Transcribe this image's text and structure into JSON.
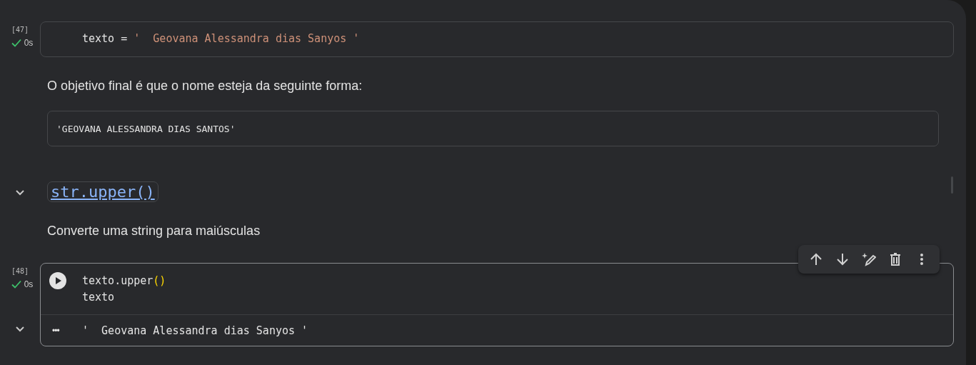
{
  "cells": [
    {
      "kind": "code",
      "exec_count": "[47]",
      "status": "0s",
      "selected": false,
      "lines": [
        [
          {
            "kind": "plain",
            "text": "texto = "
          },
          {
            "kind": "string",
            "text": "'  Geovana Alessandra dias Sanyos '"
          }
        ]
      ]
    },
    {
      "kind": "text",
      "paragraph": "O objetivo final é que o nome esteja da seguinte forma:",
      "code_block": "'GEOVANA ALESSANDRA DIAS SANTOS'"
    },
    {
      "kind": "heading",
      "expanded": true,
      "title": "str.upper()",
      "paragraph": "Converte uma string para maiúsculas"
    },
    {
      "kind": "code",
      "exec_count": "[48]",
      "status": "0s",
      "selected": true,
      "lines": [
        [
          {
            "kind": "plain",
            "text": "texto.upper"
          },
          {
            "kind": "paren",
            "text": "()"
          }
        ],
        [
          {
            "kind": "plain",
            "text": "texto"
          }
        ]
      ],
      "output": {
        "expanded": true,
        "ellipsis": "•••",
        "text": "'  Geovana Alessandra dias Sanyos '"
      }
    }
  ]
}
